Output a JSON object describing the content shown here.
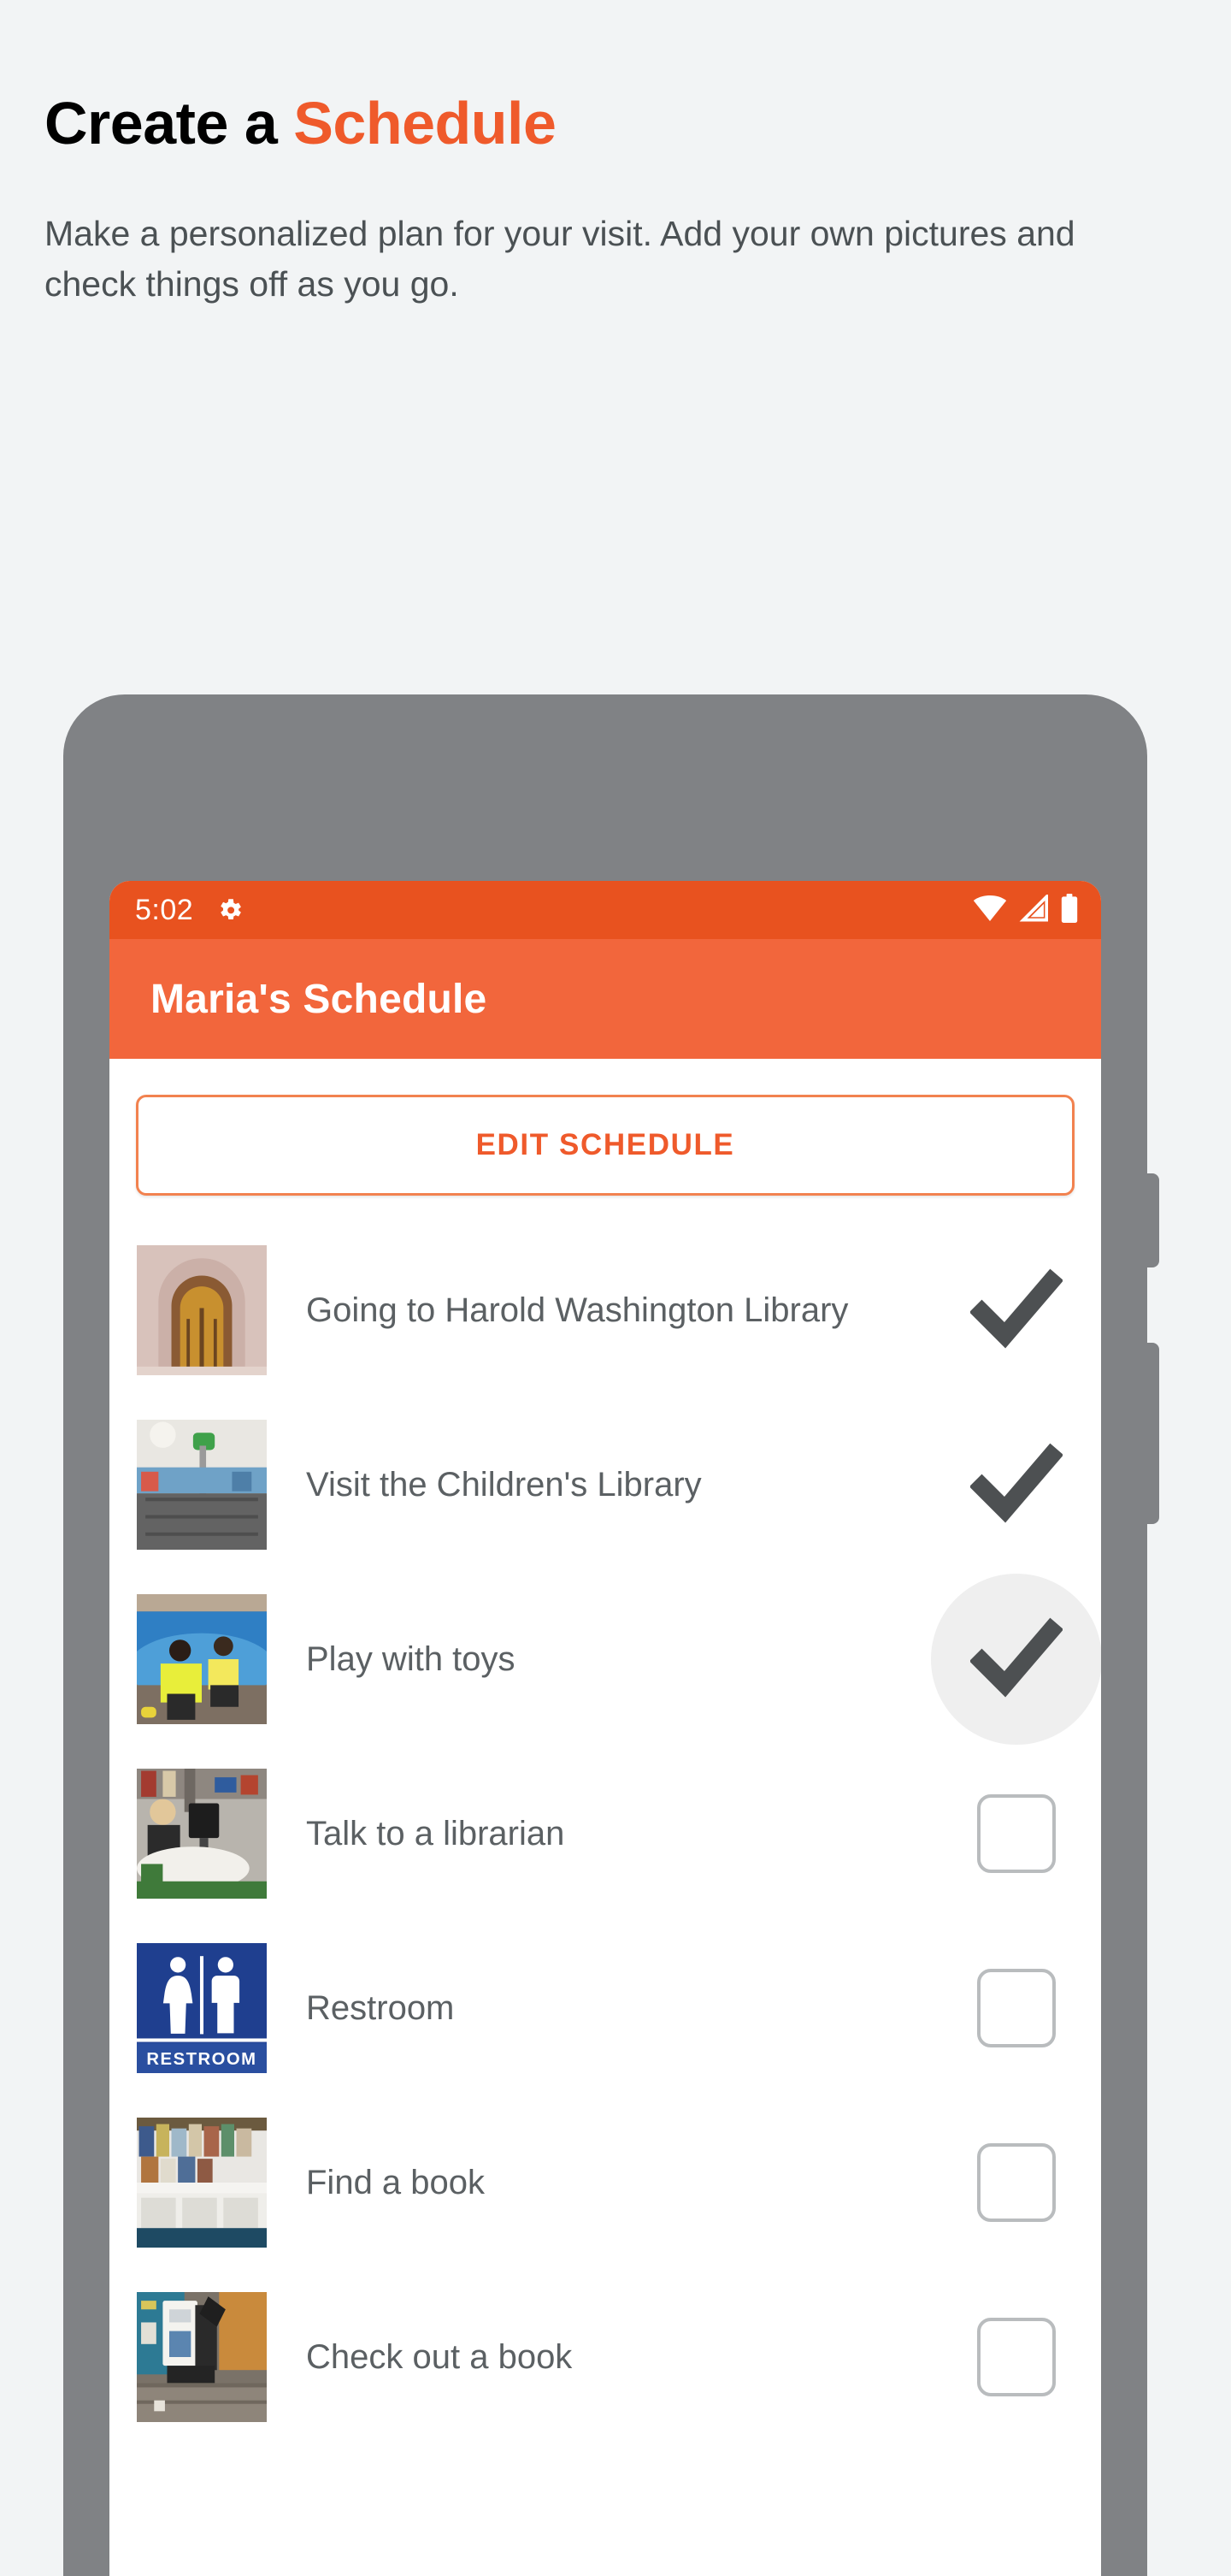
{
  "promo": {
    "title_plain": "Create a ",
    "title_accent": "Schedule",
    "body": "Make a personalized plan for your visit. Add your own pictures and check things off as you go.",
    "accent_color": "#ef5a2b",
    "body_color": "#4b5154",
    "background_color": "#f2f4f5"
  },
  "phone": {
    "frame_color": "#808285",
    "buttons": [
      {
        "name": "power-button"
      },
      {
        "name": "volume-rocker"
      }
    ]
  },
  "statusbar": {
    "time": "5:02",
    "background_color": "#e8521f",
    "icons": [
      {
        "name": "gear-icon"
      },
      {
        "name": "wifi-icon"
      },
      {
        "name": "cell-signal-icon"
      },
      {
        "name": "battery-icon"
      }
    ]
  },
  "appbar": {
    "title": "Maria's Schedule",
    "background_color": "#f2663c",
    "text_color": "#ffffff"
  },
  "content": {
    "edit_button_label": "EDIT SCHEDULE",
    "edit_button_border_color": "#f2824f",
    "edit_button_text_color": "#ef5a2b",
    "checkmark_color": "#4d5052",
    "checkbox_border_color": "#b9bcbe",
    "tasks": [
      {
        "label": "Going to Harold Washington Library",
        "checked": true,
        "highlighted": false,
        "thumb": "library-entrance-arch-photo"
      },
      {
        "label": "Visit the Children's Library",
        "checked": true,
        "highlighted": false,
        "thumb": "childrens-library-interior-photo"
      },
      {
        "label": "Play with toys",
        "checked": true,
        "highlighted": true,
        "thumb": "children-playing-with-toys-photo"
      },
      {
        "label": "Talk to a librarian",
        "checked": false,
        "highlighted": false,
        "thumb": "librarian-at-desk-photo"
      },
      {
        "label": "Restroom",
        "checked": false,
        "highlighted": false,
        "thumb": "restroom-sign-placard"
      },
      {
        "label": "Find a book",
        "checked": false,
        "highlighted": false,
        "thumb": "book-display-shelf-photo"
      },
      {
        "label": "Check out a book",
        "checked": false,
        "highlighted": false,
        "thumb": "self-checkout-kiosk-photo"
      }
    ]
  }
}
